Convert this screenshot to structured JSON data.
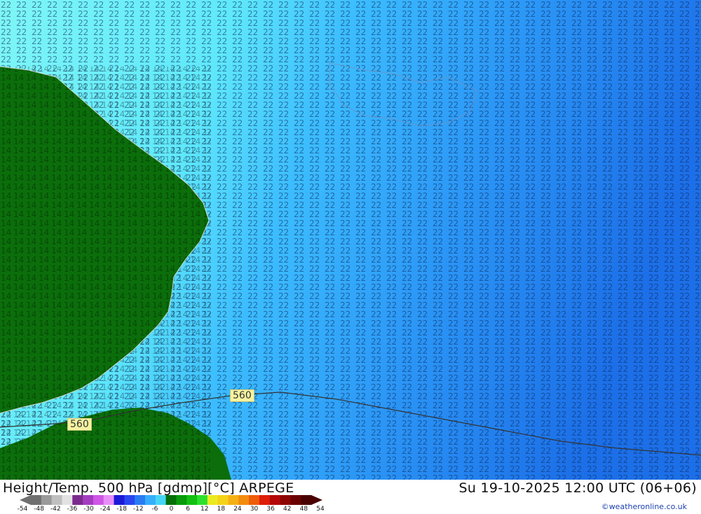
{
  "map": {
    "contour_labels": [
      "560",
      "560"
    ],
    "colors": {
      "land": "#0b6e0b",
      "sea_warm": "#7ff5f5",
      "sea_mid": "#43d2ff",
      "sea_cold": "#1e7ef0",
      "coastline": "#c9d6c9",
      "contour": "#333333"
    }
  },
  "footer": {
    "title_left": "Height/Temp. 500 hPa [gdmp][°C] ARPEGE",
    "title_right": "Su 19-10-2025 12:00 UTC (06+06)",
    "credit": "©weatheronline.co.uk"
  },
  "colorbar": {
    "ticks": [
      "-54",
      "-48",
      "-42",
      "-36",
      "-30",
      "-24",
      "-18",
      "-12",
      "-6",
      "0",
      "6",
      "12",
      "18",
      "24",
      "30",
      "36",
      "42",
      "48",
      "54"
    ],
    "colors": [
      "#707070",
      "#9a9a9a",
      "#c0c0c0",
      "#e2e2e2",
      "#7b2a8e",
      "#a43cc0",
      "#cf55e6",
      "#e88ef7",
      "#1a1ad8",
      "#2a46f0",
      "#2a7cf2",
      "#35aefc",
      "#46d6f5",
      "#066e06",
      "#0a9a0a",
      "#12c012",
      "#2ee02e",
      "#eaea20",
      "#f5d21a",
      "#f5b015",
      "#f28c0e",
      "#ef5c0a",
      "#de1e08",
      "#b40808",
      "#8c0404",
      "#6a0202",
      "#4a0101"
    ]
  }
}
